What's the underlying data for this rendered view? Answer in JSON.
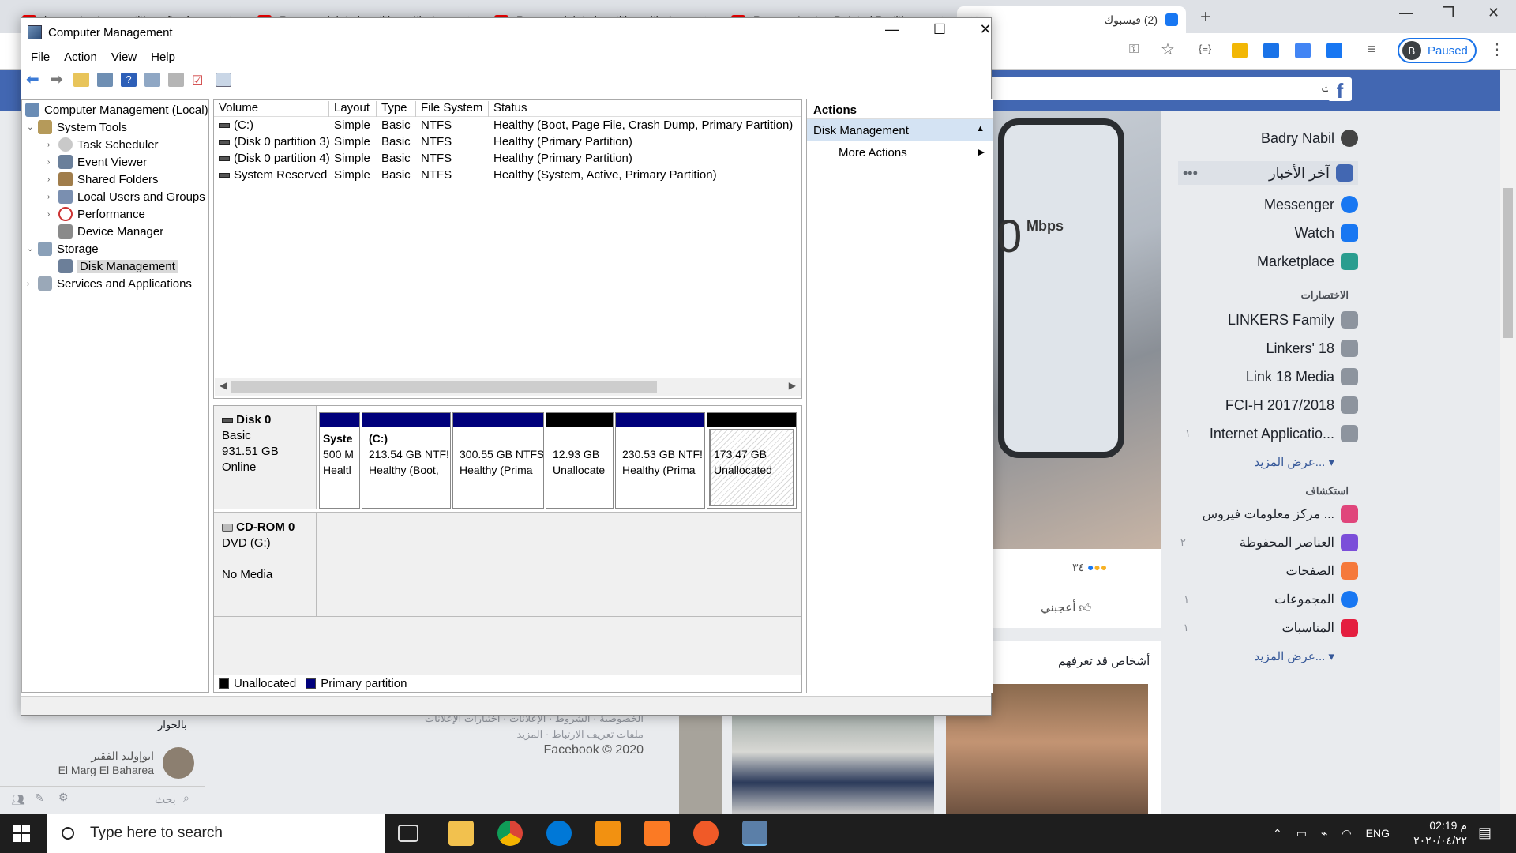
{
  "browser": {
    "tabs": [
      {
        "label": "how to backup partition after fo"
      },
      {
        "label": "Recover deleted partition with d"
      },
      {
        "label": "Recover deleted partition with d"
      },
      {
        "label": "Recover Lost or Deleted Partitio"
      }
    ],
    "active_tab": "(2) فيسبوك",
    "profile_letter": "B",
    "profile_status": "Paused"
  },
  "facebook": {
    "search_placeholder": "بحث",
    "user_name": "Badry Nabil",
    "nav": [
      {
        "label": "آخر الأخبار",
        "color": "#4267b2"
      },
      {
        "label": "Messenger",
        "color": "#1877f2"
      },
      {
        "label": "Watch",
        "color": "#1877f2"
      },
      {
        "label": "Marketplace",
        "color": "#2a9d8f"
      }
    ],
    "shortcuts_heading": "الاختصارات",
    "shortcuts": [
      {
        "label": "LINKERS Family"
      },
      {
        "label": "Linkers' 18"
      },
      {
        "label": "Link 18 Media"
      },
      {
        "label": "FCI-H 2017/2018"
      },
      {
        "label": "Internet Applicatio..."
      }
    ],
    "see_more": "عرض المزيد...",
    "explore_heading": "استكشاف",
    "explore": [
      {
        "label": "مركز معلومات فيروس ...",
        "color": "#e0457b"
      },
      {
        "label": "العناصر المحفوظة",
        "color": "#7b4ed9"
      },
      {
        "label": "الصفحات",
        "color": "#f5793b"
      },
      {
        "label": "المجموعات",
        "color": "#1877f2"
      },
      {
        "label": "المناسبات",
        "color": "#e41e3f"
      }
    ],
    "explore_counts": [
      "٢",
      "١",
      "١"
    ],
    "shortcut_count": "١",
    "reaction_count": "٣٤",
    "like_label": "أعجبني",
    "people_title": "أشخاص قد تعرفهم",
    "post_text": "Mbps",
    "post_number": "0",
    "footer_line1": "الخصوصية · الشروط · الإعلانات · اختيارات الإعلانات",
    "footer_line2": "ملفات تعريف الارتباط · المزيد",
    "footer_copy": "Facebook © 2020",
    "chat_nearby": "بالجوار",
    "chat_name": "ابوإوليد الفقير",
    "chat_location": "El Marg El Baharea",
    "chat_search": "بحث"
  },
  "window": {
    "title": "Computer Management",
    "menu": [
      "File",
      "Action",
      "View",
      "Help"
    ]
  },
  "tree": {
    "root": "Computer Management (Local)",
    "system_tools": "System Tools",
    "task_scheduler": "Task Scheduler",
    "event_viewer": "Event Viewer",
    "shared_folders": "Shared Folders",
    "local_users": "Local Users and Groups",
    "performance": "Performance",
    "device_manager": "Device Manager",
    "storage": "Storage",
    "disk_management": "Disk Management",
    "services": "Services and Applications"
  },
  "volumes": {
    "columns": [
      "Volume",
      "Layout",
      "Type",
      "File System",
      "Status"
    ],
    "rows": [
      {
        "volume": "(C:)",
        "layout": "Simple",
        "type": "Basic",
        "fs": "NTFS",
        "status": "Healthy (Boot, Page File, Crash Dump, Primary Partition)"
      },
      {
        "volume": "(Disk 0 partition 3)",
        "layout": "Simple",
        "type": "Basic",
        "fs": "NTFS",
        "status": "Healthy (Primary Partition)"
      },
      {
        "volume": "(Disk 0 partition 4)",
        "layout": "Simple",
        "type": "Basic",
        "fs": "NTFS",
        "status": "Healthy (Primary Partition)"
      },
      {
        "volume": "System Reserved",
        "layout": "Simple",
        "type": "Basic",
        "fs": "NTFS",
        "status": "Healthy (System, Active, Primary Partition)"
      }
    ]
  },
  "disk0": {
    "name": "Disk 0",
    "type": "Basic",
    "size": "931.51 GB",
    "state": "Online",
    "partitions": [
      {
        "line1": "Syste",
        "line2": "500 M",
        "line3": "Healtl",
        "color": "#00007b"
      },
      {
        "line1": "(C:)",
        "line2": "213.54 GB NTF!",
        "line3": "Healthy (Boot,",
        "color": "#00007b"
      },
      {
        "line1": "",
        "line2": "300.55 GB NTFS",
        "line3": "Healthy (Prima",
        "color": "#00007b"
      },
      {
        "line1": "",
        "line2": "12.93 GB",
        "line3": "Unallocate",
        "color": "#000000"
      },
      {
        "line1": "",
        "line2": "230.53 GB NTF!",
        "line3": "Healthy (Prima",
        "color": "#00007b"
      },
      {
        "line1": "",
        "line2": "173.47 GB",
        "line3": "Unallocated",
        "color": "#000000"
      }
    ]
  },
  "cdrom": {
    "name": "CD-ROM 0",
    "drive": "DVD (G:)",
    "media": "No Media"
  },
  "legend": {
    "unallocated": "Unallocated",
    "primary": "Primary partition"
  },
  "actions": {
    "header": "Actions",
    "selected": "Disk Management",
    "more": "More Actions"
  },
  "taskbar": {
    "search_placeholder": "Type here to search",
    "language": "ENG",
    "time": "02:19 م",
    "date": "٢٠٢٠/٠٤/٢٢"
  }
}
